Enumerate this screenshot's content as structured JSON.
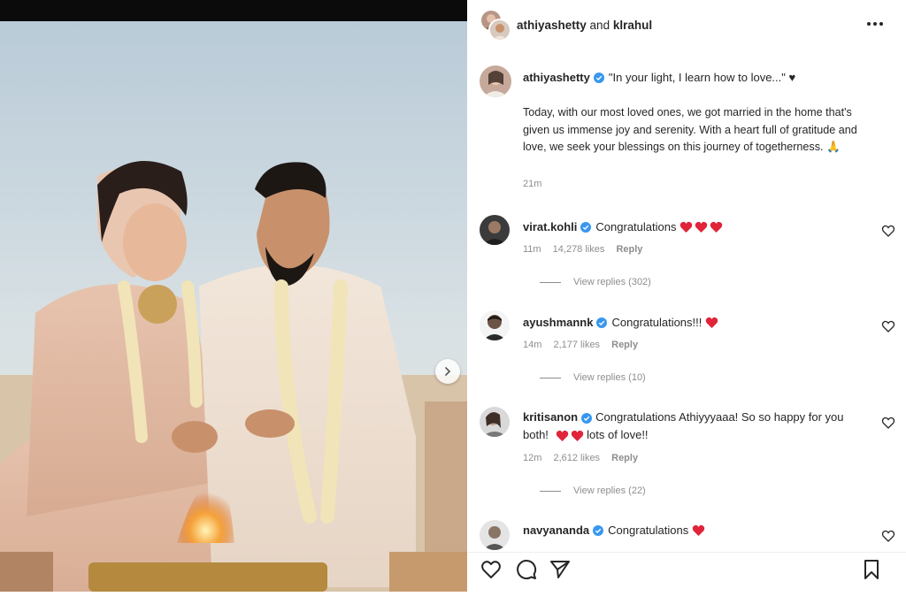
{
  "post": {
    "owners": [
      "athiyashetty",
      "klrahul"
    ],
    "owners_joiner": "and",
    "author": "athiyashetty",
    "caption_quote": "\"In your light, I learn how to love...\" ♥",
    "caption_body": "Today, with our most loved ones, we got married in the home that's given us immense joy and serenity. With a heart full of gratitude and love, we seek your blessings on this journey of togetherness. 🙏",
    "caption_time": "21m"
  },
  "icons": {
    "more": "more-horizontal-icon",
    "verified": "verified-badge-icon",
    "heart": "heart-outline-icon",
    "comment": "comment-icon",
    "share": "share-icon",
    "save": "bookmark-icon",
    "carousel_next": "chevron-right-icon"
  },
  "colors": {
    "verified": "#3897f0",
    "heart_red": "#e0243a",
    "meta_gray": "#8e8e8e"
  },
  "comments": [
    {
      "username": "virat.kohli",
      "text": "Congratulations",
      "hearts": 3,
      "time": "11m",
      "likes": "14,278 likes",
      "reply": "Reply",
      "view_replies": "View replies (302)"
    },
    {
      "username": "ayushmannk",
      "text": "Congratulations!!!",
      "hearts": 1,
      "time": "14m",
      "likes": "2,177 likes",
      "reply": "Reply",
      "view_replies": "View replies (10)"
    },
    {
      "username": "kritisanon",
      "text_a": "Congratulations Athiyyyaaa! So so happy for you both!",
      "text_b": "lots of love!!",
      "hearts": 2,
      "time": "12m",
      "likes": "2,612 likes",
      "reply": "Reply",
      "view_replies": "View replies (22)"
    },
    {
      "username": "navyananda",
      "text": "Congratulations",
      "hearts": 1
    }
  ]
}
